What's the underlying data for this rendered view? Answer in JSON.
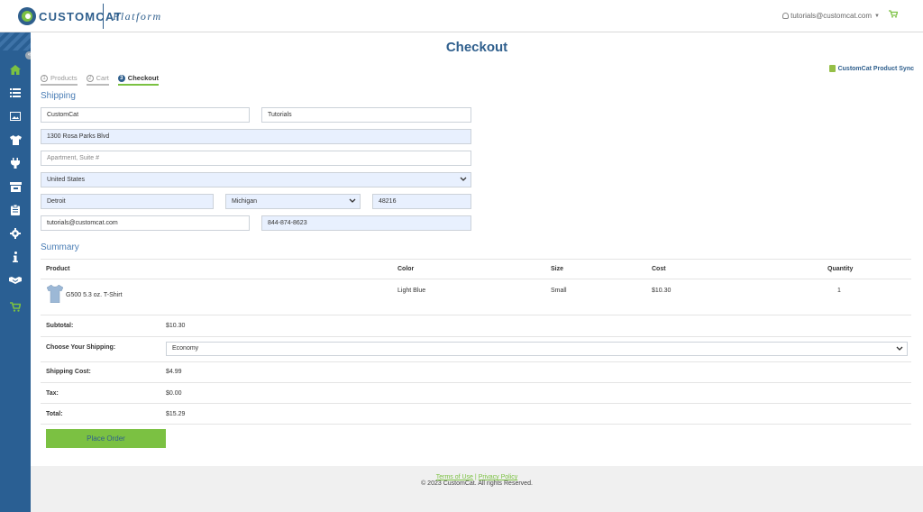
{
  "brand": {
    "name": "CUSTOMCAT",
    "platform": "Platform",
    "accent": "#7bc142",
    "primary": "#2f5f8d"
  },
  "header": {
    "user_email": "tutorials@customcat.com",
    "icons": [
      "user-icon",
      "chevron-down-icon",
      "cart-icon"
    ]
  },
  "sidebar": {
    "toggle": "«",
    "items": [
      "home-icon",
      "list-icon",
      "image-icon",
      "tshirt-icon",
      "plug-icon",
      "store-icon",
      "clipboard-icon",
      "gear-icon",
      "info-icon",
      "handshake-icon",
      "cart-icon"
    ]
  },
  "page": {
    "title": "Checkout",
    "sync_link": "CustomCat Product Sync"
  },
  "steps": [
    {
      "num": "1",
      "label": "Products"
    },
    {
      "num": "2",
      "label": "Cart"
    },
    {
      "num": "3",
      "label": "Checkout"
    }
  ],
  "shipping": {
    "title": "Shipping",
    "first_name": "CustomCat",
    "last_name": "Tutorials",
    "address1": "1300 Rosa Parks Blvd",
    "address2_placeholder": "Apartment, Suite #",
    "country": "United States",
    "city": "Detroit",
    "state": "Michigan",
    "zip": "48216",
    "email": "tutorials@customcat.com",
    "phone": "844-874-8623"
  },
  "summary": {
    "title": "Summary",
    "columns": [
      "Product",
      "Color",
      "Size",
      "Cost",
      "Quantity"
    ],
    "items": [
      {
        "product": "G500 5.3 oz. T-Shirt",
        "color": "Light Blue",
        "size": "Small",
        "cost": "$10.30",
        "quantity": "1"
      }
    ],
    "subtotal_label": "Subtotal:",
    "subtotal": "$10.30",
    "shipping_choice_label": "Choose Your Shipping:",
    "shipping_choice": "Economy",
    "shipping_cost_label": "Shipping Cost:",
    "shipping_cost": "$4.99",
    "tax_label": "Tax:",
    "tax": "$0.00",
    "total_label": "Total:",
    "total": "$15.29"
  },
  "actions": {
    "place_order": "Place Order"
  },
  "footer": {
    "terms": "Terms of Use",
    "separator": "|",
    "privacy": "Privacy Policy",
    "copyright": "© 2023 CustomCat. All rights Reserved."
  }
}
